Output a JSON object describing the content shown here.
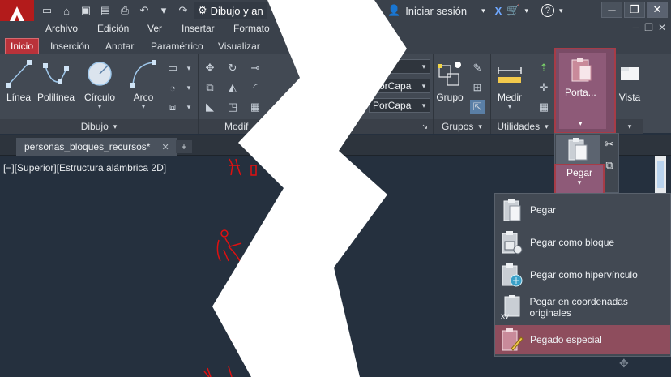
{
  "window": {
    "workspace_label": "Dibujo y an",
    "signin_label": "Iniciar sesión"
  },
  "menubar": {
    "items": [
      "Archivo",
      "Edición",
      "Ver",
      "Insertar",
      "Formato"
    ]
  },
  "ribbon": {
    "tabs": [
      "Inicio",
      "Inserción",
      "Anotar",
      "Paramétrico",
      "Visualizar"
    ],
    "active_tab": "Inicio",
    "draw_tools": [
      "Línea",
      "Polilínea",
      "Círculo",
      "Arco"
    ],
    "panel_dibujo": "Dibujo",
    "panel_modificar": "Modif",
    "combo_1": "PorCapa",
    "combo_2": "PorCapa",
    "grupo_label": "Grupo",
    "panel_grupos": "Grupos",
    "medir_label": "Medir",
    "panel_utilidades": "Utilidades",
    "porta_label": "Porta...",
    "vista_label": "Vista"
  },
  "filetabs": {
    "active": "personas_bloques_recursos*"
  },
  "viewport": {
    "label": "[−][Superior][Estructura alámbrica 2D]"
  },
  "paste": {
    "label": "Pegar",
    "menu": [
      {
        "label": "Pegar",
        "icon": "paste-icon"
      },
      {
        "label": "Pegar como bloque",
        "icon": "paste-as-block-icon"
      },
      {
        "label": "Pegar como hipervínculo",
        "icon": "paste-hyperlink-icon"
      },
      {
        "label": "Pegar en coordenadas originales",
        "icon": "paste-original-coords-icon"
      },
      {
        "label": "Pegado especial",
        "icon": "paste-special-icon"
      }
    ],
    "highlighted_index": 4
  },
  "colors": {
    "app_red": "#b31b1b",
    "accent_highlight": "#8e5a78",
    "drawing_red": "#e01010"
  }
}
